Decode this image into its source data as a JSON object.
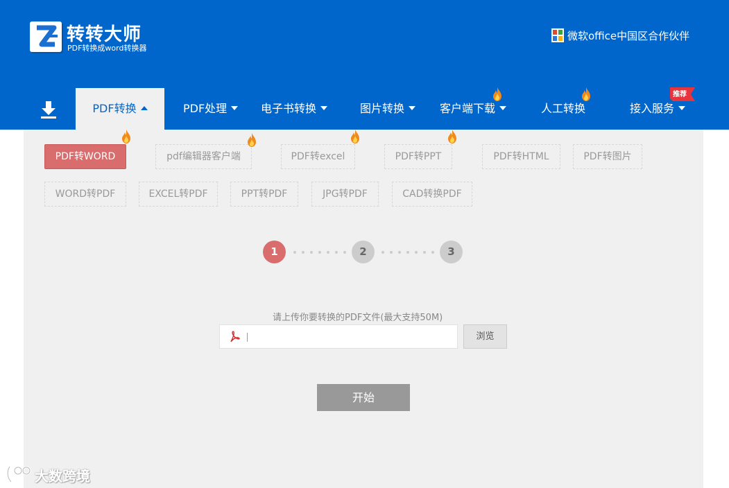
{
  "brand": {
    "title": "转转大师",
    "subtitle": "PDF转换成word转换器",
    "partner": "微软office中国区合作伙伴"
  },
  "nav": {
    "download_icon": "download-icon",
    "items": [
      {
        "label": "PDF转换",
        "active": true,
        "caret": "up"
      },
      {
        "label": "PDF处理",
        "caret": "down"
      },
      {
        "label": "电子书转换",
        "caret": "down"
      },
      {
        "label": "图片转换",
        "caret": "down"
      },
      {
        "label": "客户端下载",
        "caret": "down",
        "hot": true
      },
      {
        "label": "人工转换",
        "hot": true
      },
      {
        "label": "接入服务",
        "caret": "down",
        "badge": "推荐"
      }
    ]
  },
  "tools": {
    "row1": [
      {
        "label": "PDF转WORD",
        "active": true,
        "hot": true
      },
      {
        "label": "pdf编辑器客户端",
        "hot": true
      },
      {
        "label": "PDF转excel",
        "hot": true
      },
      {
        "label": "PDF转PPT",
        "hot": true
      },
      {
        "label": "PDF转HTML"
      },
      {
        "label": "PDF转图片"
      }
    ],
    "row2": [
      {
        "label": "WORD转PDF"
      },
      {
        "label": "EXCEL转PDF"
      },
      {
        "label": "PPT转PDF"
      },
      {
        "label": "JPG转PDF"
      },
      {
        "label": "CAD转换PDF"
      }
    ]
  },
  "steps": [
    "1",
    "2",
    "3"
  ],
  "current_step": 1,
  "upload": {
    "label": "请上传你要转换的PDF文件(最大支持50M)",
    "value": "",
    "browse_label": "浏览"
  },
  "start_label": "开始",
  "watermark": "大数跨境",
  "colors": {
    "header_bg": "#0066cc",
    "accent_red": "#d96c6c",
    "content_bg": "#f0f0f0"
  }
}
